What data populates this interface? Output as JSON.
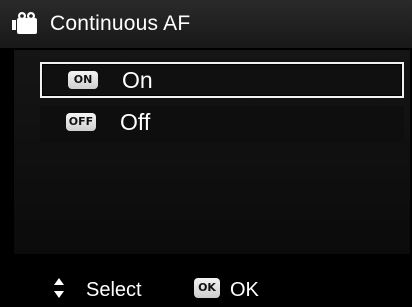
{
  "header": {
    "title": "Continuous AF",
    "icon": "video-camera-icon"
  },
  "menu": {
    "items": [
      {
        "badge": "ON",
        "label": "On",
        "selected": true
      },
      {
        "badge": "OFF",
        "label": "Off",
        "selected": false
      }
    ]
  },
  "footer": {
    "select_label": "Select",
    "ok_icon_text": "OK",
    "ok_label": "OK"
  },
  "colors": {
    "background": "#000000",
    "header": "#1f1f1f",
    "text": "#ffffff",
    "selection_border": "#f2f2f2"
  }
}
